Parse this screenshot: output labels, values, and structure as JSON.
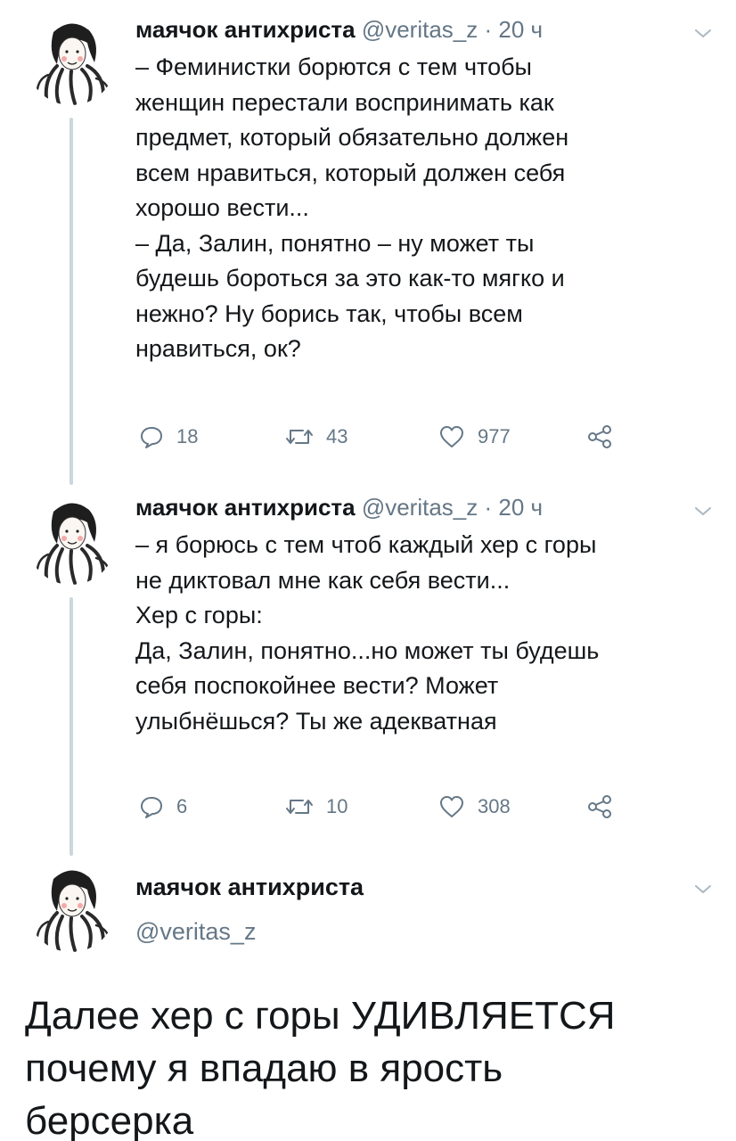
{
  "tweets": [
    {
      "name": "маячок антихриста",
      "handle": "@veritas_z",
      "dot": "·",
      "time": "20 ч",
      "lines": [
        "– Феминистки борются с тем чтобы",
        "женщин перестали воспринимать как",
        "предмет, который обязательно должен",
        "всем нравиться, который должен себя",
        "хорошо вести...",
        "– Да, Залин, понятно – ну может ты",
        "будешь бороться за это как-то мягко и",
        "нежно? Ну борись так, чтобы всем",
        "нравиться, ок?"
      ],
      "replies": "18",
      "retweets": "43",
      "likes": "977"
    },
    {
      "name": "маячок антихриста",
      "handle": "@veritas_z",
      "dot": "·",
      "time": "20 ч",
      "lines": [
        "– я борюсь с тем чтоб каждый хер с горы",
        "не диктовал мне как себя вести...",
        "Хер с горы:",
        "Да, Залин, понятно...но может ты будешь",
        "себя поспокойнее вести? Может",
        "улыбнёшься? Ты же адекватная"
      ],
      "replies": "6",
      "retweets": "10",
      "likes": "308"
    }
  ],
  "focus": {
    "name": "маячок антихриста",
    "handle": "@veritas_z",
    "lines": [
      "Далее хер с горы УДИВЛЯЕТСЯ",
      "почему я впадаю в ярость",
      "берсерка"
    ]
  },
  "icons": {
    "reply": "reply-icon",
    "retweet": "retweet-icon",
    "like": "heart-icon",
    "share": "share-icon",
    "menu": "chevron-down-icon"
  },
  "colors": {
    "text": "#14171a",
    "secondary": "#657786",
    "thread_line": "#ccd6dd"
  }
}
